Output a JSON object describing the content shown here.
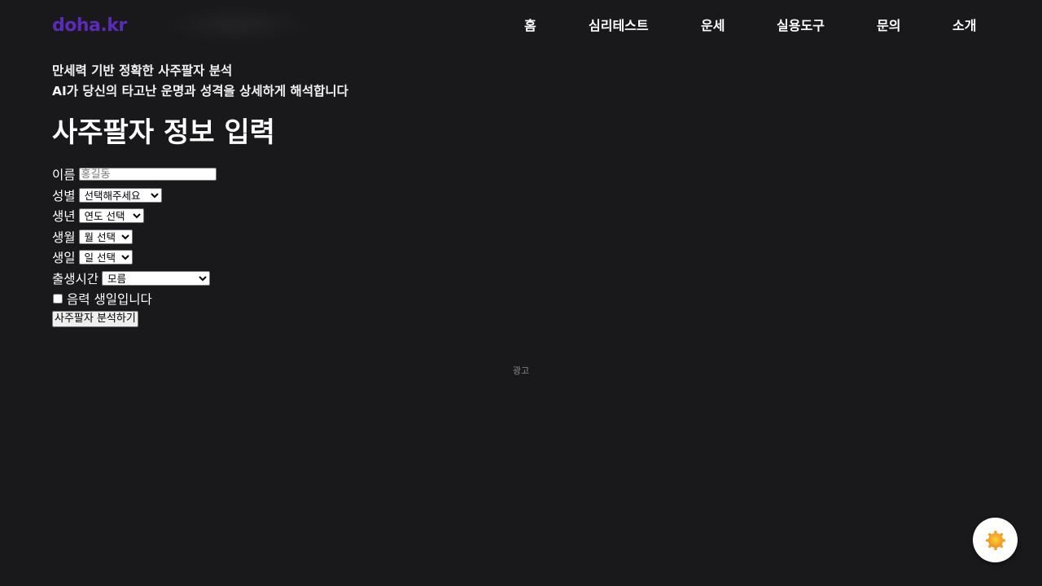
{
  "header": {
    "logo": "doha.kr",
    "nav": [
      {
        "label": "홈"
      },
      {
        "label": "심리테스트"
      },
      {
        "label": "운세"
      },
      {
        "label": "실용도구"
      },
      {
        "label": "문의"
      },
      {
        "label": "소개"
      }
    ]
  },
  "intro": {
    "line1": "만세력 기반 정확한 사주팔자 분석",
    "line2": "AI가 당신의 타고난 운명과 성격을 상세하게 해석합니다"
  },
  "form": {
    "title": "사주팔자 정보 입력",
    "name_label": "이름",
    "name_placeholder": "홍길동",
    "name_value": "",
    "gender_label": "성별",
    "gender_selected": "선택해주세요",
    "year_label": "생년",
    "year_selected": "연도 선택",
    "month_label": "생월",
    "month_selected": "월 선택",
    "day_label": "생일",
    "day_selected": "일 선택",
    "time_label": "출생시간",
    "time_selected": "모름",
    "lunar_label": "음력 생일입니다",
    "lunar_checked": false,
    "submit_label": "사주팔자 분석하기"
  },
  "ad": {
    "label": "광고"
  },
  "theme_toggle": {
    "icon": "sun-icon",
    "accent": "#f5a623"
  },
  "colors": {
    "background": "#19181b",
    "brand": "#5a2bb8"
  }
}
